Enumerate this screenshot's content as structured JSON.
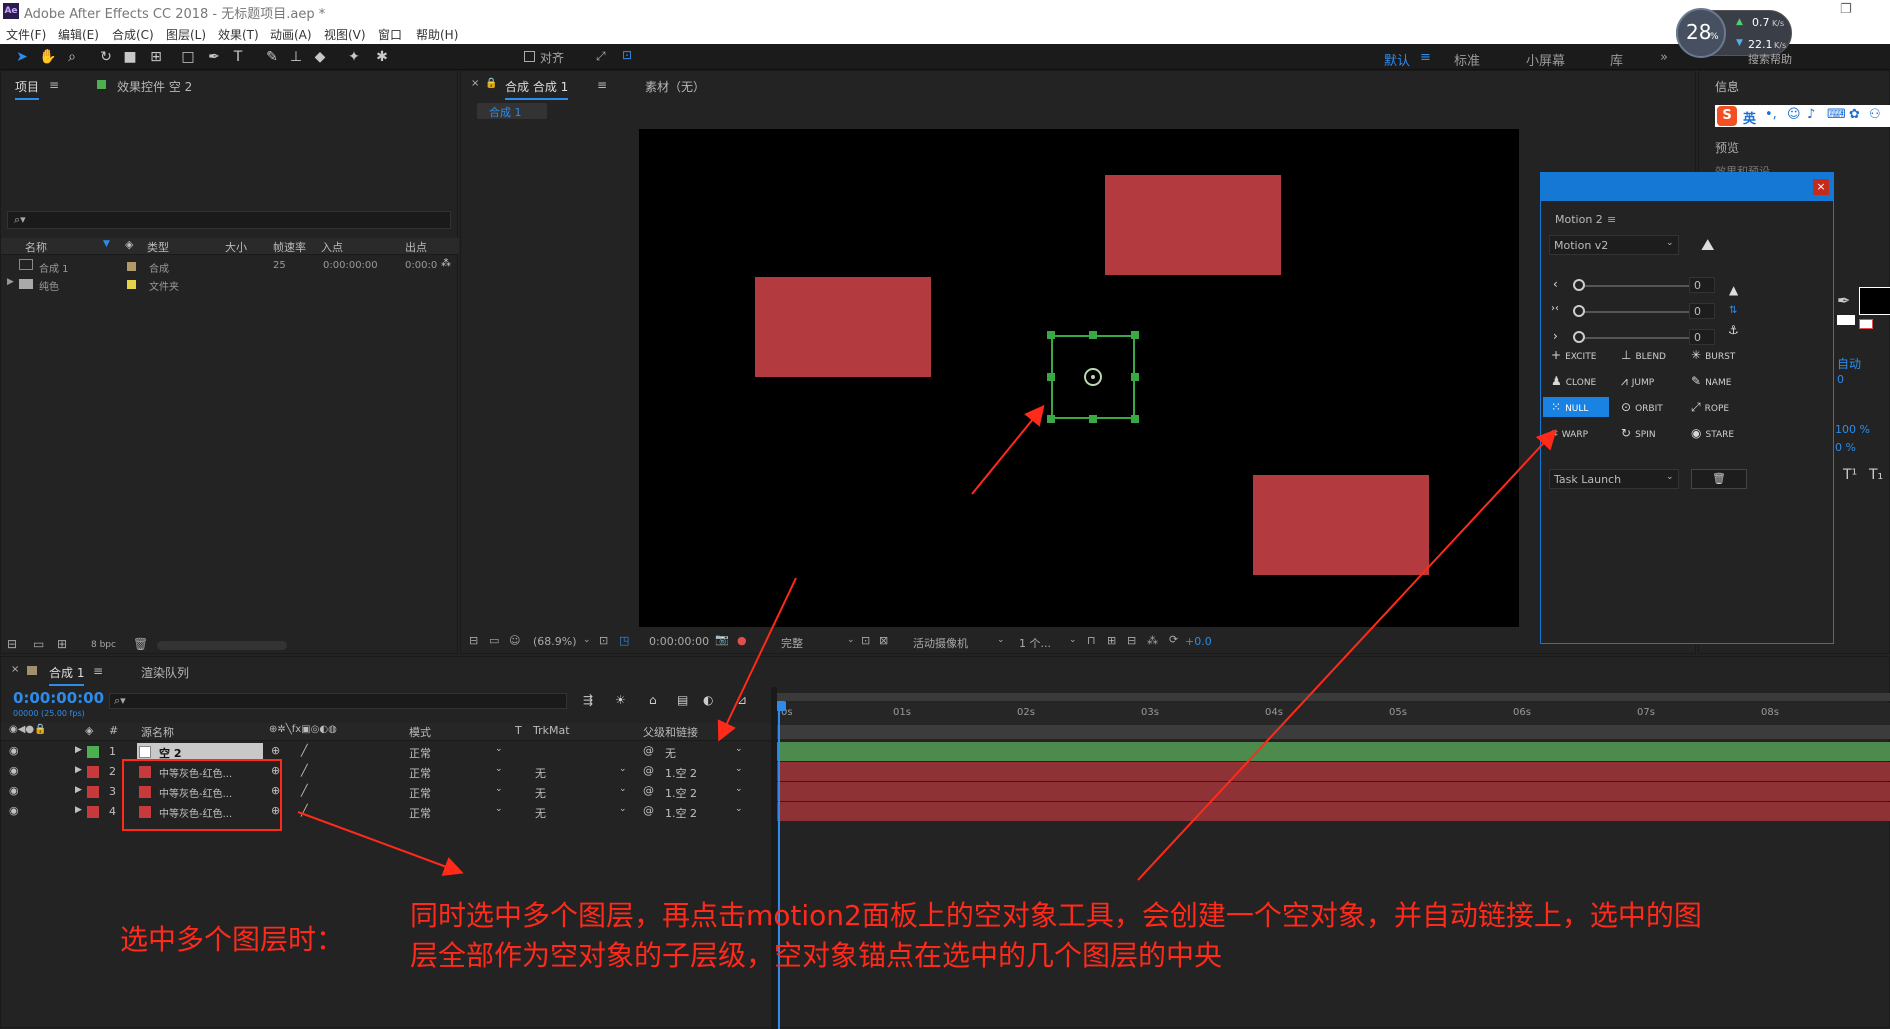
{
  "window": {
    "title": "Adobe After Effects CC 2018 - 无标题项目.aep *",
    "ae_logo": "Ae"
  },
  "menu": [
    "文件(F)",
    "编辑(E)",
    "合成(C)",
    "图层(L)",
    "效果(T)",
    "动画(A)",
    "视图(V)",
    "窗口",
    "帮助(H)"
  ],
  "toolbar": {
    "snap_label": "对齐",
    "workspaces": [
      "默认",
      "标准",
      "小屏幕",
      "库"
    ],
    "more": "»"
  },
  "net_widget": {
    "percent": "28",
    "percent_unit": "%",
    "up": "0.7",
    "up_unit": "K/s",
    "down": "22.1",
    "down_unit": "K/s",
    "help": "搜索帮助"
  },
  "project_panel": {
    "tab_project": "项目",
    "tab_effects": "效果控件 空 2",
    "columns": [
      "名称",
      "类型",
      "大小",
      "帧速率",
      "入点",
      "出点"
    ],
    "items": [
      {
        "name": "合成 1",
        "type": "合成",
        "fps": "25",
        "in": "0:00:00:00",
        "out": "0:00:0",
        "color": "#b09a6a"
      },
      {
        "name": "纯色",
        "type": "文件夹",
        "fps": "",
        "in": "",
        "out": "",
        "color": "#e6d24a"
      }
    ],
    "bpc": "8 bpc"
  },
  "comp_panel": {
    "tab": "合成 合成 1",
    "tab_footage": "素材（无）",
    "subtab": "合成 1",
    "zoom": "(68.9%)",
    "time": "0:00:00:00",
    "quality": "完整",
    "camera": "活动摄像机",
    "views": "1 个...",
    "exposure": "+0.0"
  },
  "right_panel": {
    "info": "信息",
    "preview": "预览",
    "auto": "自动",
    "pct1": "100 %",
    "pct2": "0 %",
    "ime": "英",
    "ime_extra": "效果和预设"
  },
  "motion2": {
    "title": "Motion 2",
    "preset": "Motion v2",
    "sliders": [
      {
        "icon": "‹",
        "value": "0"
      },
      {
        "icon": "›‹",
        "value": "0"
      },
      {
        "icon": "›",
        "value": "0"
      }
    ],
    "buttons": [
      [
        "EXCITE",
        "BLEND",
        "BURST"
      ],
      [
        "CLONE",
        "JUMP",
        "NAME"
      ],
      [
        "NULL",
        "ORBIT",
        "ROPE"
      ],
      [
        "WARP",
        "SPIN",
        "STARE"
      ]
    ],
    "task": "Task Launch",
    "close": "×"
  },
  "timeline": {
    "tab": "合成 1",
    "tab_render": "渲染队列",
    "timecode": "0:00:00:00",
    "frames": "00000 (25.00 fps)",
    "col_headers": {
      "num": "#",
      "name": "源名称",
      "mode": "模式",
      "t": "T",
      "trkmat": "TrkMat",
      "parent": "父级和链接"
    },
    "layers": [
      {
        "num": "1",
        "name": "空 2",
        "mode": "正常",
        "trkmat": "",
        "parent": "无",
        "label": "#4caf50"
      },
      {
        "num": "2",
        "name": "中等灰色-红色...",
        "mode": "正常",
        "trkmat": "无",
        "parent": "1.空 2",
        "label": "#c8393b"
      },
      {
        "num": "3",
        "name": "中等灰色-红色...",
        "mode": "正常",
        "trkmat": "无",
        "parent": "1.空 2",
        "label": "#c8393b"
      },
      {
        "num": "4",
        "name": "中等灰色-红色...",
        "mode": "正常",
        "trkmat": "无",
        "parent": "1.空 2",
        "label": "#c8393b"
      }
    ],
    "ruler": [
      "0s",
      "01s",
      "02s",
      "03s",
      "04s",
      "05s",
      "06s",
      "07s",
      "08s"
    ]
  },
  "annotations": {
    "left": "选中多个图层时：",
    "right_line1": "同时选中多个图层，再点击motion2面板上的空对象工具，会创建一个空对象，并自动链接上，选中的图",
    "right_line2": "层全部作为空对象的子层级，空对象锚点在选中的几个图层的中央"
  }
}
